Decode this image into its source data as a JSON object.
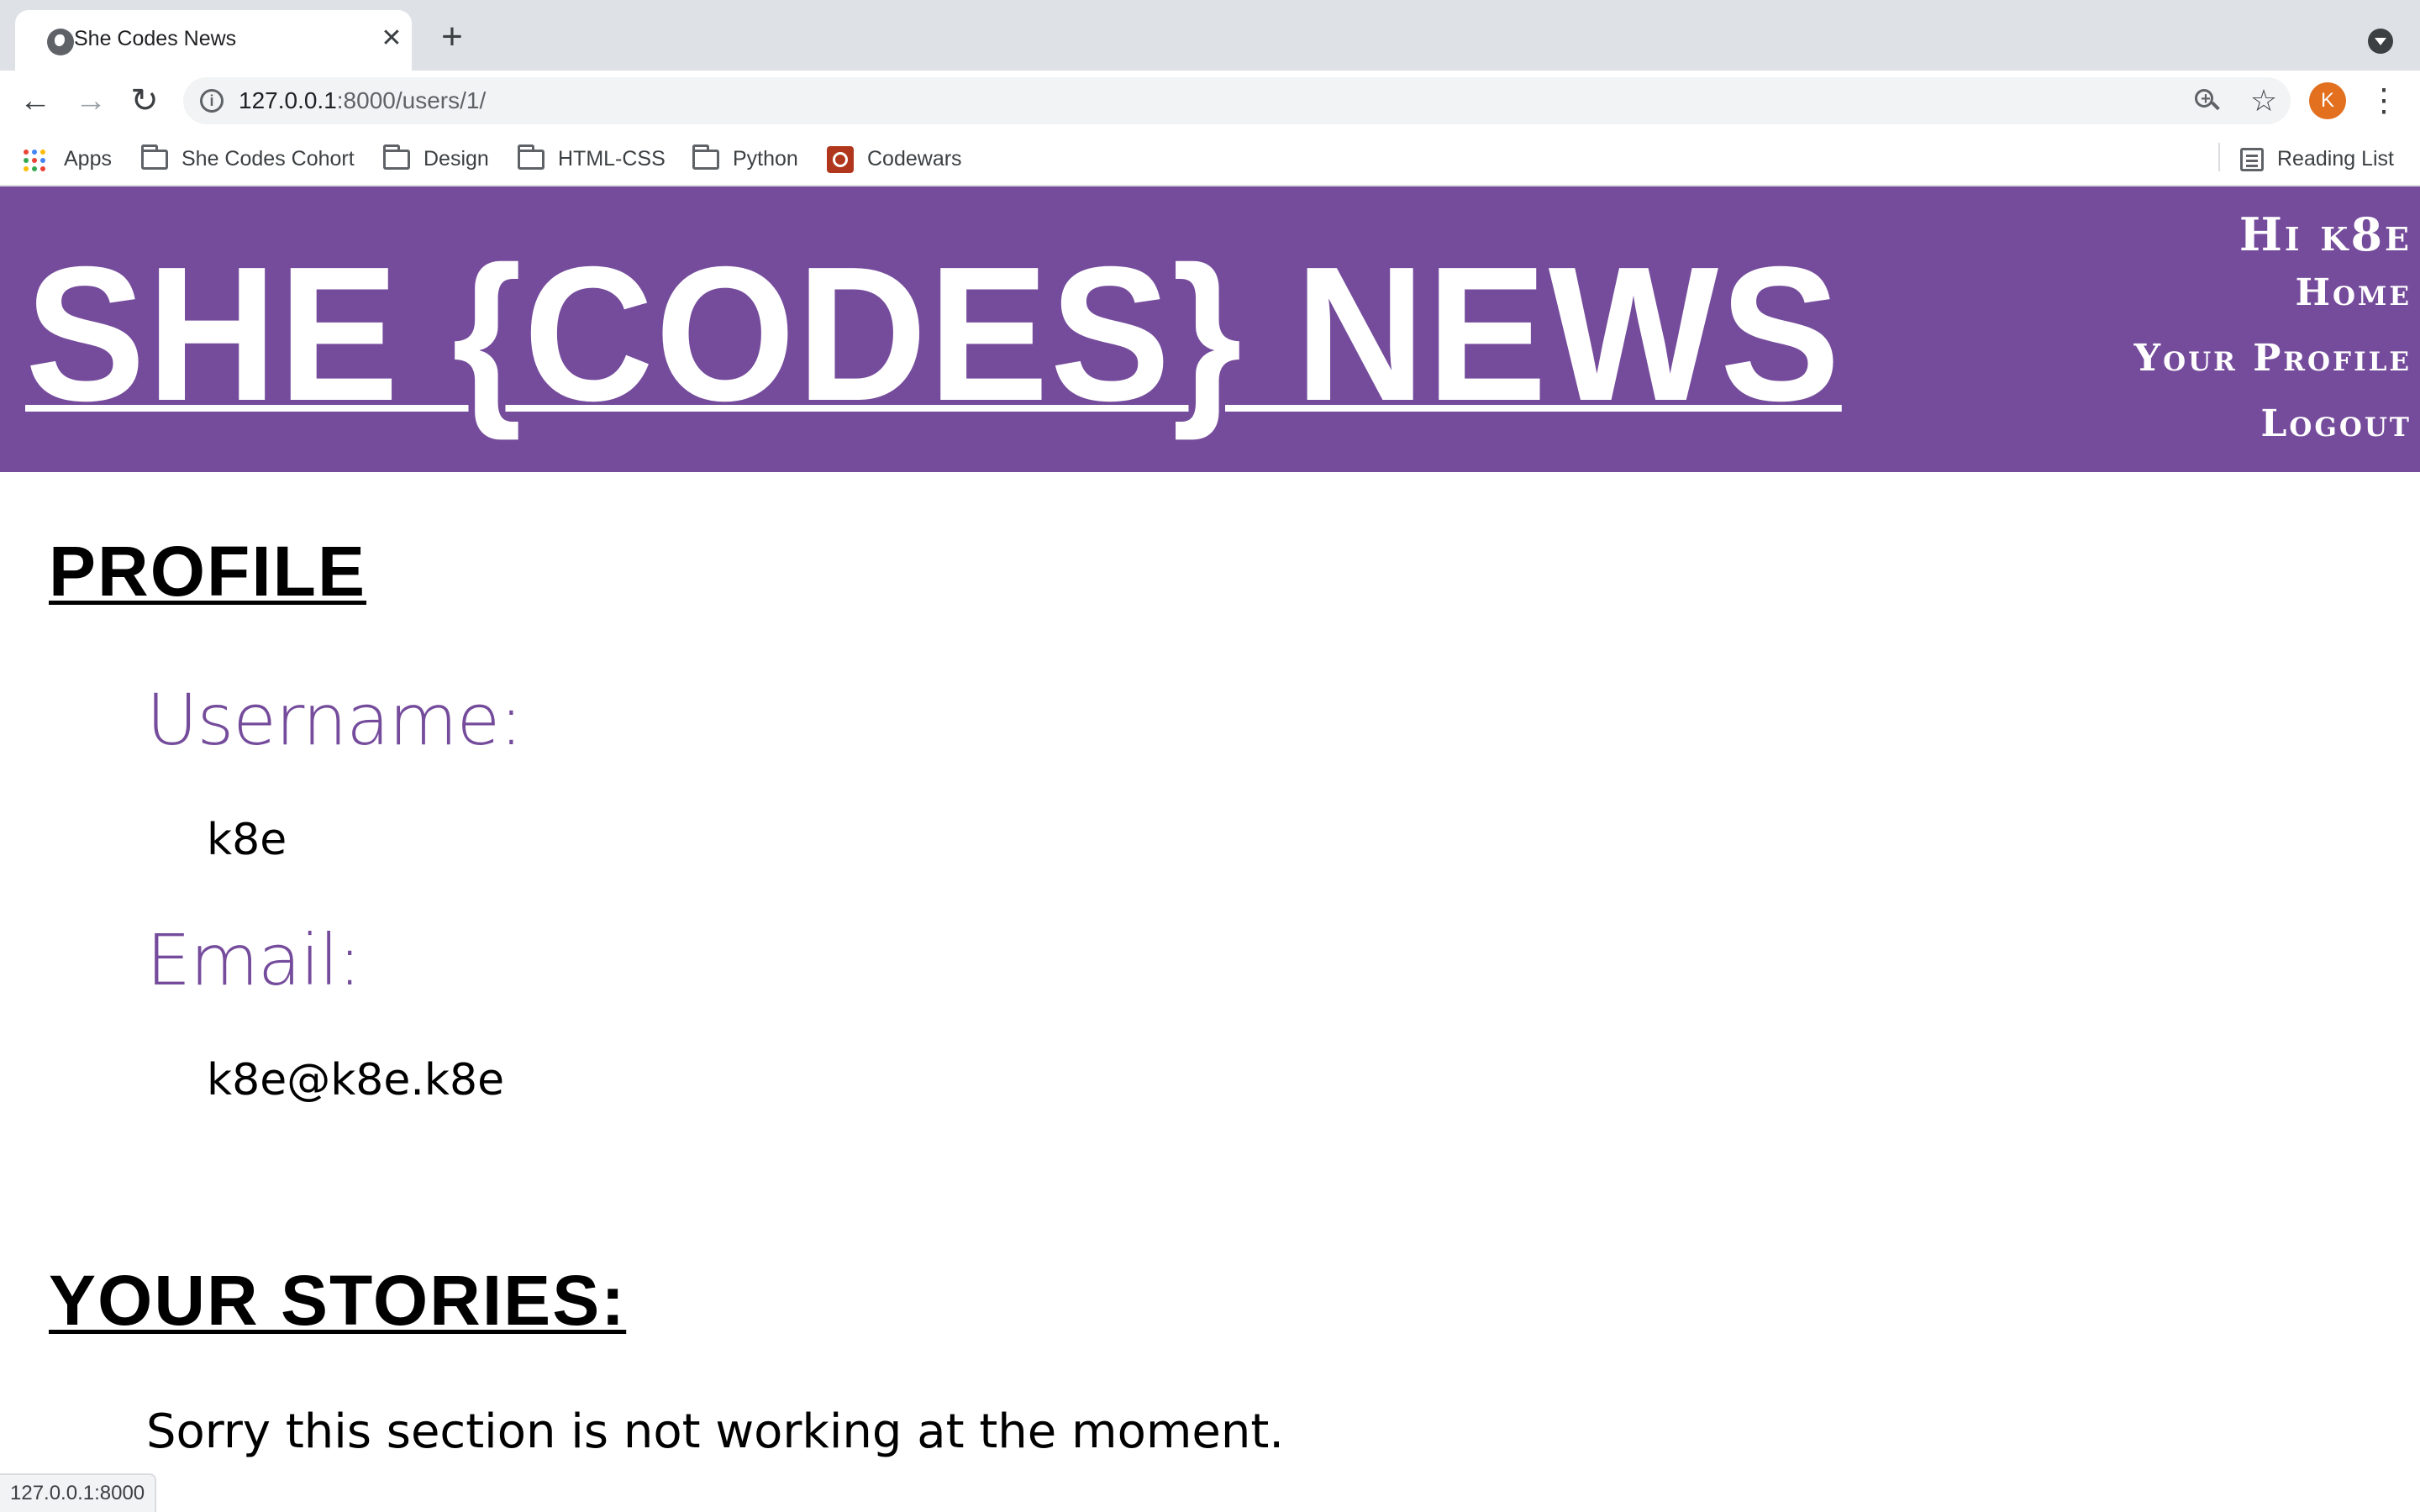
{
  "browser": {
    "tab": {
      "title": "She Codes News",
      "close_glyph": "✕"
    },
    "new_tab_glyph": "+",
    "address_bar": {
      "host": "127.0.0.1",
      "rest": ":8000/users/1/"
    },
    "nav": {
      "back_glyph": "←",
      "forward_glyph": "→",
      "reload_glyph": "↻"
    },
    "star_glyph": "☆",
    "menu_glyph": "⋮",
    "profile_initial": "K",
    "profile_color": "#e2701f",
    "bookmarks": [
      {
        "label": "Apps",
        "icon": "apps-grid-icon"
      },
      {
        "label": "She Codes Cohort",
        "icon": "folder-icon"
      },
      {
        "label": "Design",
        "icon": "folder-icon"
      },
      {
        "label": "HTML-CSS",
        "icon": "folder-icon"
      },
      {
        "label": "Python",
        "icon": "folder-icon"
      },
      {
        "label": "Codewars",
        "icon": "codewars-icon"
      }
    ],
    "reading_list": "Reading List",
    "status_url": "127.0.0.1:8000"
  },
  "site": {
    "brand_color": "#754c9c",
    "logo": "SHE {CODES} NEWS",
    "nav": {
      "greeting": "Hi k8e",
      "home": "Home",
      "profile": "Your Profile",
      "logout": "Logout"
    }
  },
  "profile": {
    "heading": "PROFILE",
    "username_label": "Username:",
    "username": "k8e",
    "email_label": "Email:",
    "email": "k8e@k8e.k8e"
  },
  "stories": {
    "heading": "YOUR STORIES:",
    "message": "Sorry this section is not working at the moment."
  }
}
